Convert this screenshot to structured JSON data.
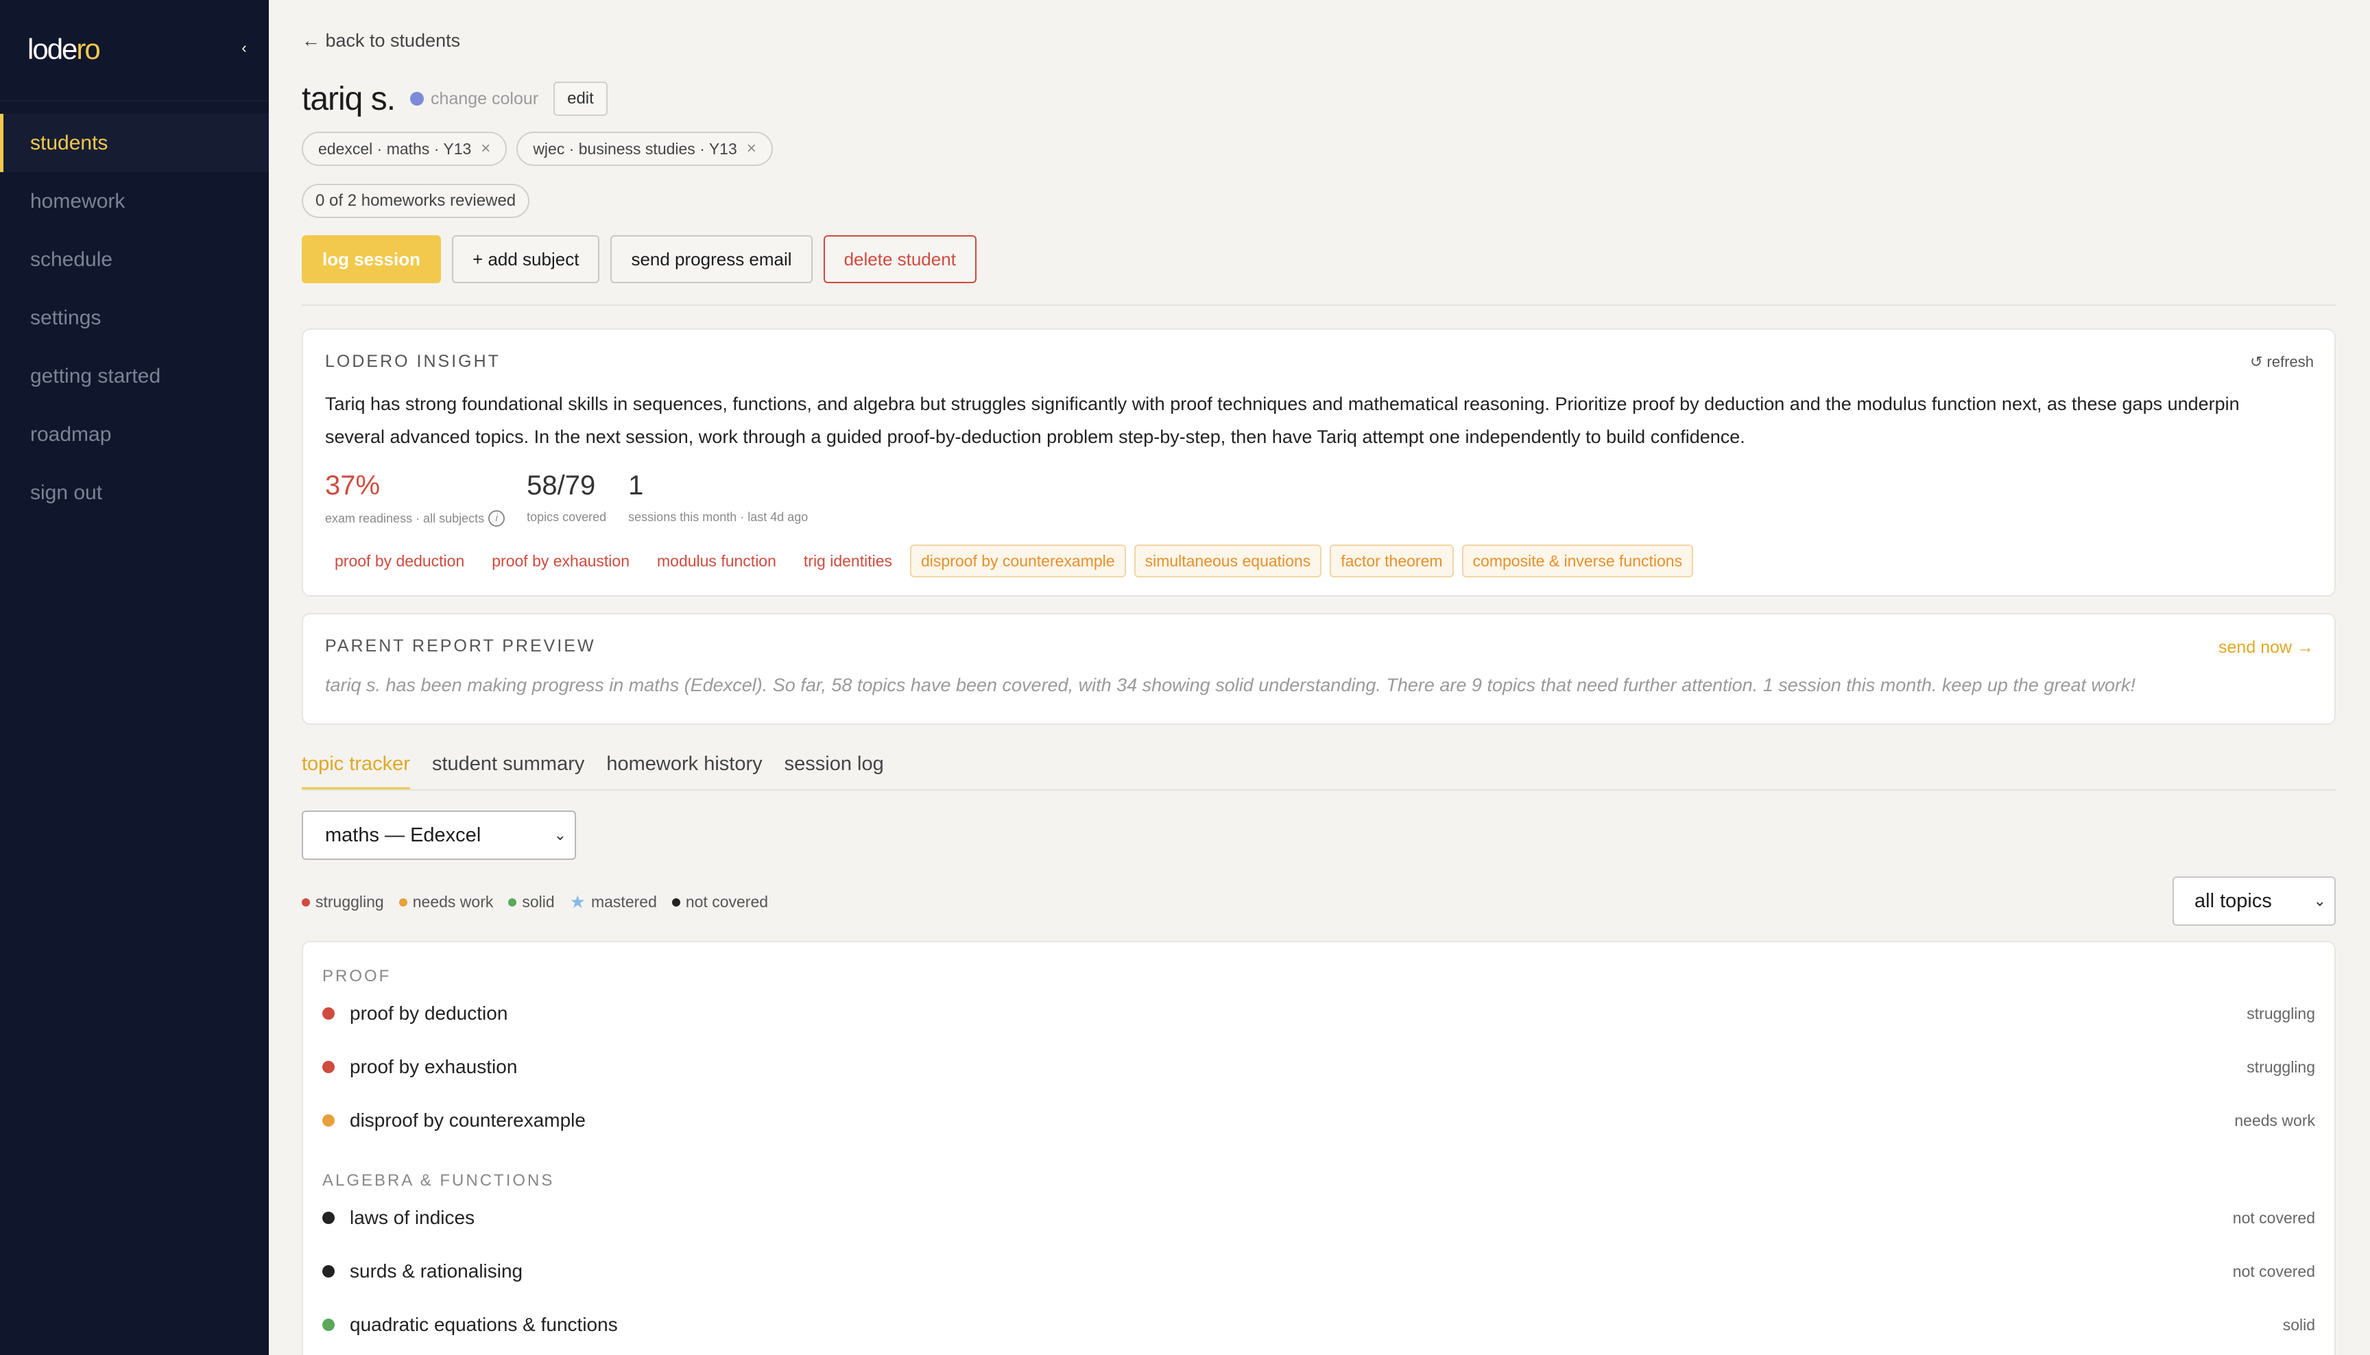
{
  "app": {
    "logo_main": "lode",
    "logo_accent": "ro"
  },
  "sidebar": {
    "items": [
      {
        "label": "students",
        "active": true
      },
      {
        "label": "homework"
      },
      {
        "label": "schedule"
      },
      {
        "label": "settings"
      },
      {
        "label": "getting started"
      },
      {
        "label": "roadmap"
      },
      {
        "label": "sign out"
      }
    ]
  },
  "header": {
    "back_label": "← back to students",
    "student_name": "tariq s.",
    "change_colour": "change colour",
    "edit_label": "edit",
    "colour": "#7d8bd8",
    "subjects": [
      {
        "label": "edexcel · maths · Y13"
      },
      {
        "label": "wjec · business studies · Y13"
      }
    ],
    "homework_status": "0 of 2 homeworks reviewed"
  },
  "actions": {
    "log_session": "log session",
    "add_subject": "+ add subject",
    "send_progress": "send progress email",
    "delete_student": "delete student"
  },
  "insight": {
    "title": "LODERO INSIGHT",
    "refresh": "↺ refresh",
    "text": "Tariq has strong foundational skills in sequences, functions, and algebra but struggles significantly with proof techniques and mathematical reasoning. Prioritize proof by deduction and the modulus function next, as these gaps underpin several advanced topics. In the next session, work through a guided proof-by-deduction problem step-by-step, then have Tariq attempt one independently to build confidence.",
    "stats": [
      {
        "value": "37%",
        "label": "exam readiness · all subjects"
      },
      {
        "value": "58/79",
        "label": "topics covered"
      },
      {
        "value": "1",
        "label": "sessions this month · last 4d ago"
      }
    ],
    "struggling_tags": [
      "proof by deduction",
      "proof by exhaustion",
      "modulus function",
      "trig identities"
    ],
    "needs_work_tags": [
      "disproof by counterexample",
      "simultaneous equations",
      "factor theorem",
      "composite & inverse functions"
    ]
  },
  "parent_report": {
    "title": "PARENT REPORT PREVIEW",
    "send_now": "send now →",
    "text": "tariq s. has been making progress in maths (Edexcel). So far, 58 topics have been covered, with 34 showing solid understanding. There are 9 topics that need further attention. 1 session this month. keep up the great work!"
  },
  "tabs": [
    {
      "label": "topic tracker",
      "active": true
    },
    {
      "label": "student summary"
    },
    {
      "label": "homework history"
    },
    {
      "label": "session log"
    }
  ],
  "tracker": {
    "subject_selected": "maths — Edexcel",
    "filter_selected": "all topics",
    "legend": [
      {
        "label": "struggling",
        "color": "#d04b3f"
      },
      {
        "label": "needs work",
        "color": "#e8a13a"
      },
      {
        "label": "solid",
        "color": "#5aa85a"
      },
      {
        "label": "mastered",
        "color": "#8ab8e8"
      },
      {
        "label": "not covered",
        "color": "#222222"
      }
    ],
    "sections": [
      {
        "title": "PROOF",
        "topics": [
          {
            "name": "proof by deduction",
            "status": "struggling",
            "color": "#d04b3f"
          },
          {
            "name": "proof by exhaustion",
            "status": "struggling",
            "color": "#d04b3f"
          },
          {
            "name": "disproof by counterexample",
            "status": "needs work",
            "color": "#e8a13a"
          }
        ]
      },
      {
        "title": "ALGEBRA & FUNCTIONS",
        "topics": [
          {
            "name": "laws of indices",
            "status": "not covered",
            "color": "#222222"
          },
          {
            "name": "surds & rationalising",
            "status": "not covered",
            "color": "#222222"
          },
          {
            "name": "quadratic equations & functions",
            "status": "solid",
            "color": "#5aa85a"
          }
        ]
      }
    ]
  }
}
